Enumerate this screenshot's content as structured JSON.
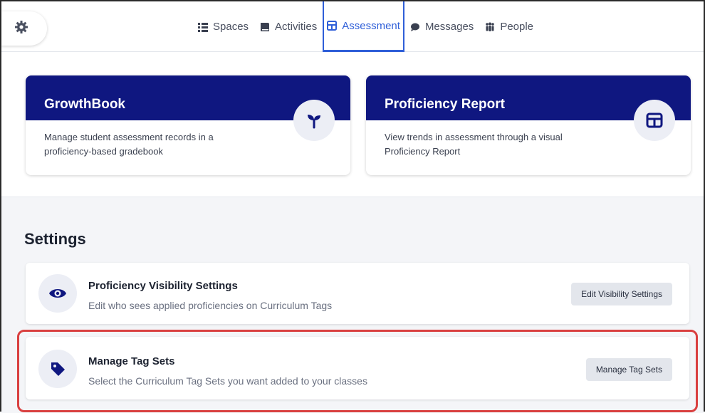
{
  "nav": {
    "items": [
      {
        "label": "Spaces",
        "icon": "list-icon"
      },
      {
        "label": "Activities",
        "icon": "book-icon"
      },
      {
        "label": "Assessment",
        "icon": "table-icon"
      },
      {
        "label": "Messages",
        "icon": "chat-icon"
      },
      {
        "label": "People",
        "icon": "people-icon"
      }
    ],
    "active": "Assessment"
  },
  "cards": [
    {
      "title": "GrowthBook",
      "description": "Manage student assessment records in a proficiency-based gradebook",
      "icon": "sprout-icon"
    },
    {
      "title": "Proficiency Report",
      "description": "View trends in assessment through a visual Proficiency Report",
      "icon": "table-icon"
    }
  ],
  "settings": {
    "title": "Settings",
    "rows": [
      {
        "title": "Proficiency Visibility Settings",
        "description": "Edit who sees applied proficiencies on Curriculum Tags",
        "button": "Edit Visibility Settings",
        "icon": "eye-icon"
      },
      {
        "title": "Manage Tag Sets",
        "description": "Select the Curriculum Tag Sets you want added to your classes",
        "button": "Manage Tag Sets",
        "icon": "tag-icon"
      }
    ]
  },
  "colors": {
    "header_navy": "#0f1780",
    "active_blue": "#2f5fd8",
    "highlight_red": "#d94040"
  }
}
